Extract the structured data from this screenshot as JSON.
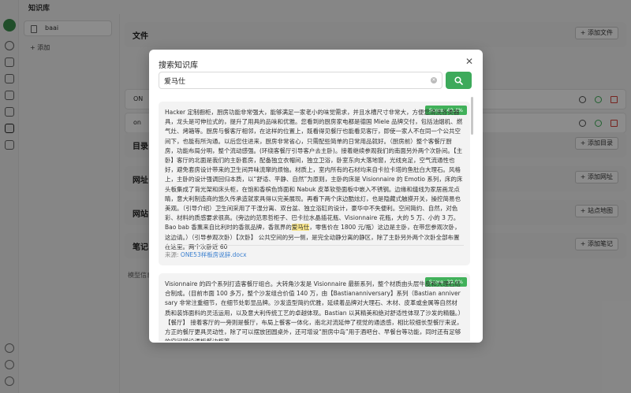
{
  "app": {
    "title": "知识库"
  },
  "kb_list": {
    "items": [
      {
        "label": "baai"
      }
    ],
    "add_label": "添加"
  },
  "main": {
    "sections": [
      {
        "title": "文件",
        "button": "添加文件"
      },
      {
        "title": "目录",
        "button": "添加目录"
      },
      {
        "title": "网址",
        "button": "添加网址"
      },
      {
        "title": "网站",
        "button": "站点地图"
      },
      {
        "title": "笔记",
        "button": "添加笔记"
      }
    ],
    "files": [
      {
        "label": "ON"
      },
      {
        "label": "on"
      }
    ],
    "model_info": "模型信息"
  },
  "modal": {
    "title": "搜索知识库",
    "query": "爱马仕",
    "results": [
      {
        "score": "Score: 40.4%",
        "text_before": "Hacker 定制橱柜，厨房功能非常强大，能够满足一家老小的味觉需求，并且水槽尺寸非常大，方便您清洗各类器具，龙头是可伸拉式的，提升了用具的品味和优雅。您看到的厨房家电都是德国 Miele 品牌交付，包括油烟机、燃气灶、烤箱等。厨房与餐客厅相邻，在这样的位置上，既看得见餐厅也能看见客厅，即使一家人不在同一个公共空间下，也能有所沟通。以后您住进来，厨房非常省心，只需配些简单的日常用品就好。（厨房前）整个客餐厅厨房，功能布局分明，整个流动感强。(环绕客餐厅引导客户去主卧)。接着继续参观我们的南面另外两个次卧间。【主卧】客厅的北面是我们的主卧套房，配备独立衣帽间，独立卫浴，卧室东向大落地窗，光线充足，空气流通性也好，避免套房设计带来的卫生间异味流窜的烦恼。材质上，室内所有的石材均来自卡拉卡塔的鱼肚白大理石。风格上，主卧的设计强调回归本质，以“舒适、平静、自然”为原则，主卧的床是 Visionnaire 的 Emotio 系列，床的床头板集成了背光架和床头柜，在饱和香槟色饰面和 Nabuk 皮革软垫面板中嵌入不锈钢。边缘和缝线为家居画龙点睛，意大利制造商的悠久传承造就家具得以完美展现。再看下两个床边酷炫灯，也是隐藏式触摸开关，操控简易也美观。（引导介绍）卫生间采用了干湿分离、双台盆、独立浴缸的设计，豪华中不失便利。空间简约、自然，对色彩、材料的质感要求很高。(旁边的范思哲柜子、巴卡拉水晶插花瓶、Visionnaire 花瓶，大的 5 万、小的 3 万。Bao bab 香薰来自比利时的香氛品牌，香氛界的",
        "highlight": "爱马仕",
        "text_after": "，零售价在 1800 元/瓶）这边是主卧，在带您参观次卧，这边请。）（引导参观次卧）【次卧】 公共空间的另一侧，是完全动静分离的静区，除了主卧另外两个次卧全部布置在这里。两个次卧近 60",
        "source_label": "来源:",
        "source_file": "ONE53样板房说辞.docx"
      },
      {
        "score": "Score: 39.0%",
        "text": "Visionnaire 的四个系列打造客餐厅组合。大转角沙发是 Visionnaire 最新系列，整个材质由头层牛皮和大理石结合制成。(目前市面 100 多万，整个沙发组合价值 140 万，由【Bastiananniversary】系列（Bastian anniversary 非常注重细节，在细节处彰显品牌。沙发造型简约优雅，延续着品牌对大理石、木材、皮革或金属等自然材质和装饰面料的灵活运用，以及意大利传统工艺的卓越体现。Bastian 以其精美和绝对舒适性体现了沙发的精髓。）【餐厅】 接着客厅的一旁则是餐厅，布局上餐客一体化，南北对流延伸了视觉的通透感，相比较细长型餐厅来说，方正的餐厅更具灵动性，除了可以摆放团圆桌外，还可增设“厨房中岛”用于酒吧台、早餐台等功能，同时还有足够的空间增设酒柜餐边柜等"
      }
    ]
  }
}
